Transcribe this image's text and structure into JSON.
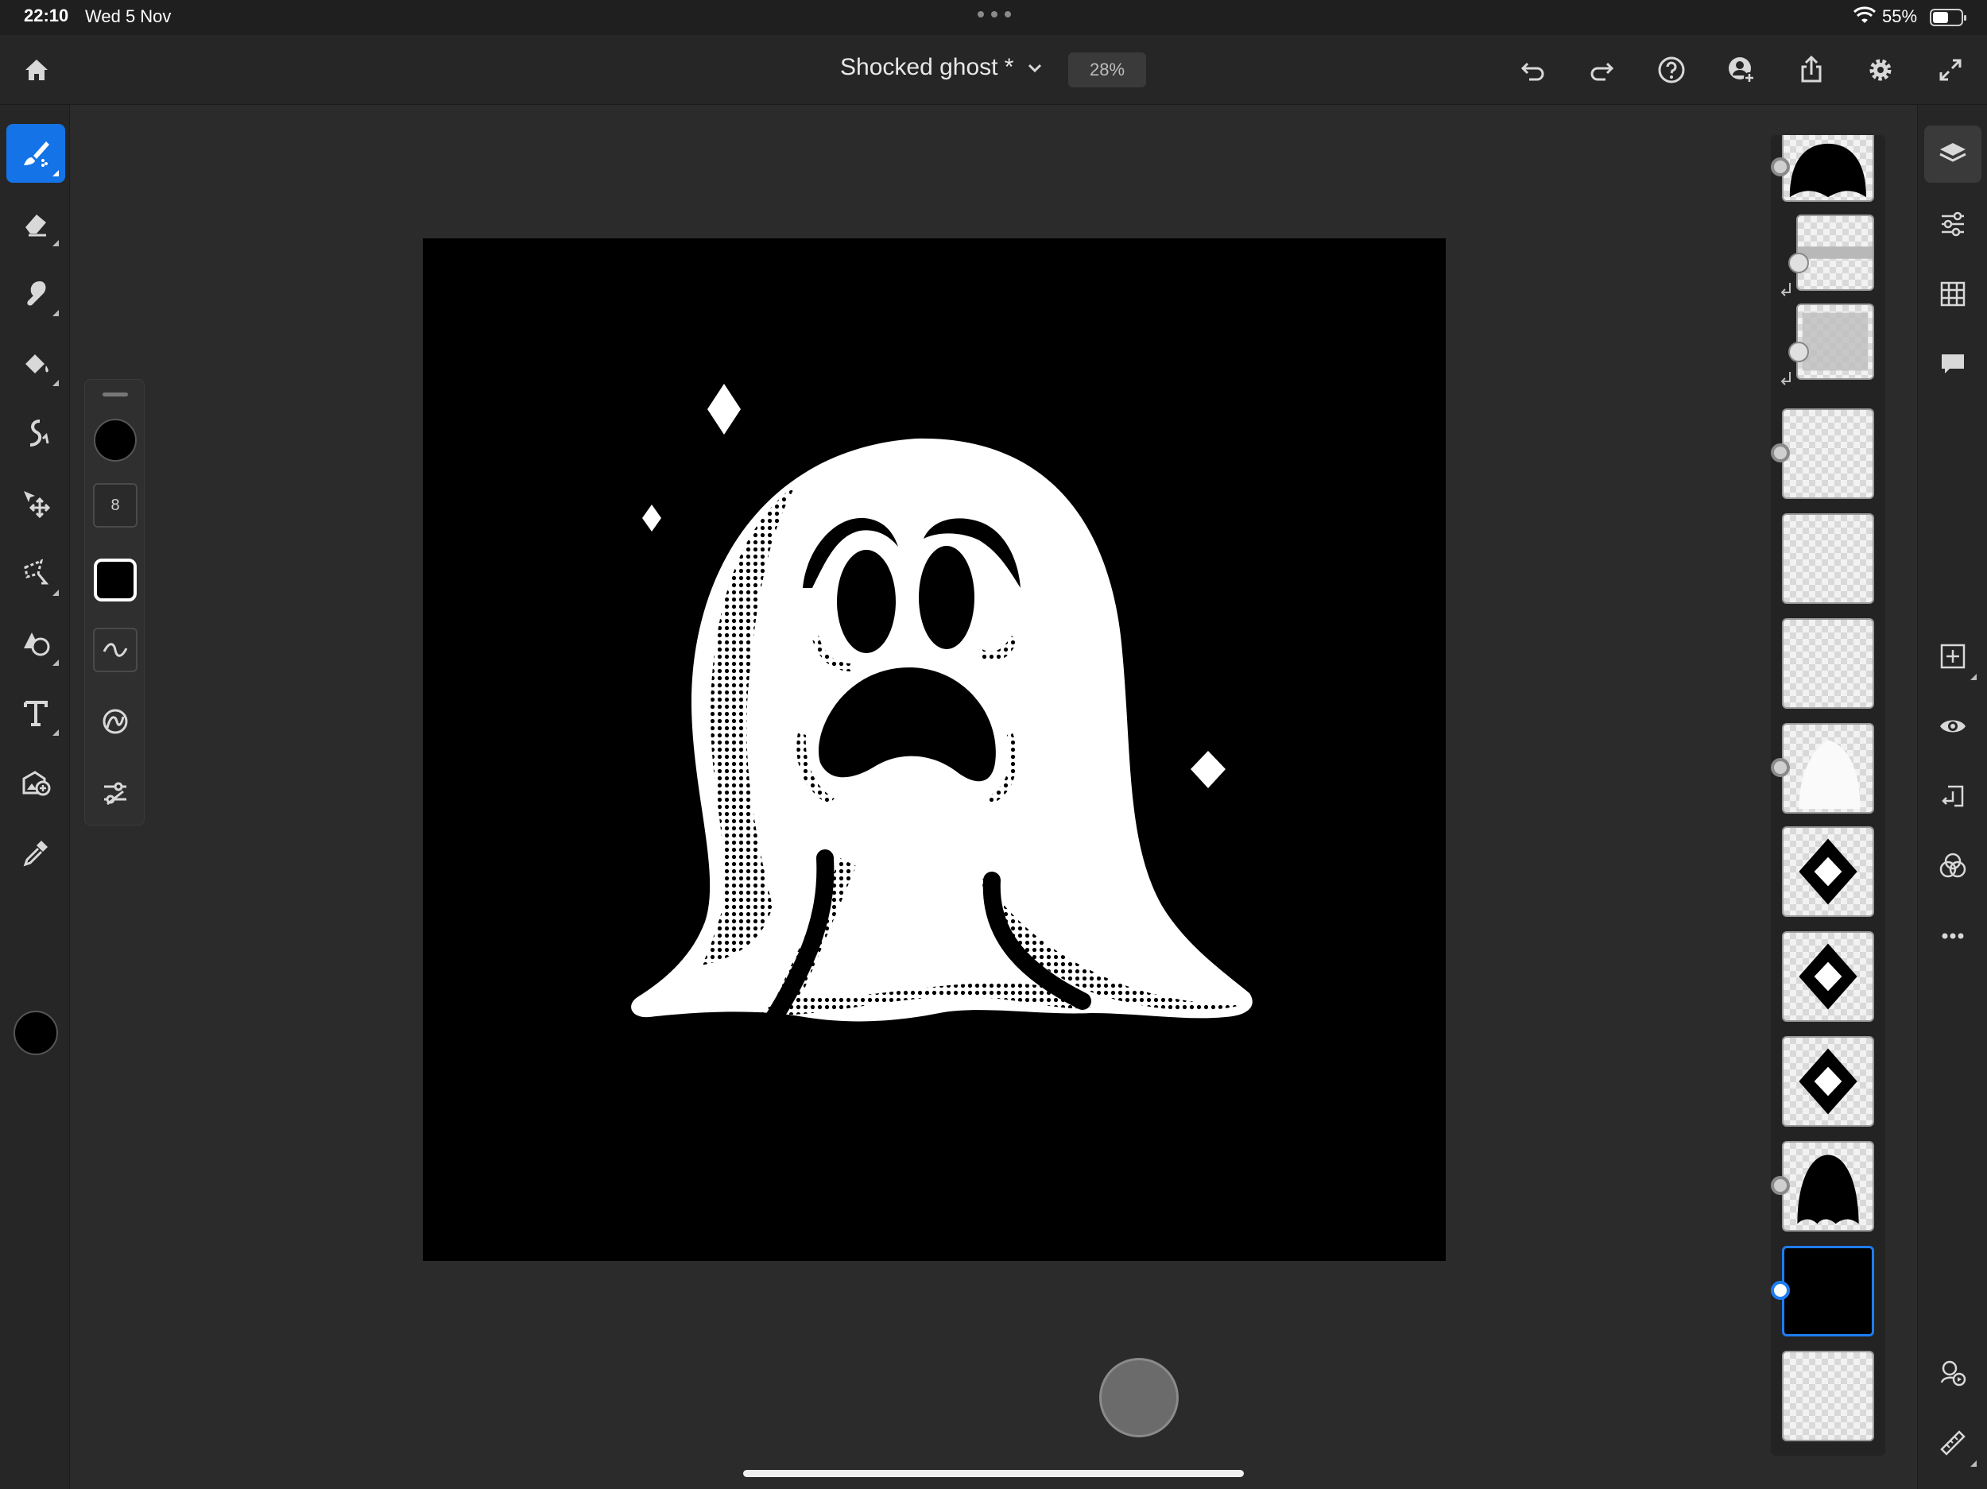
{
  "status_bar": {
    "time": "22:10",
    "date": "Wed 5 Nov",
    "battery_percent": "55%",
    "battery_level": 0.55
  },
  "header": {
    "document_title": "Shocked ghost *",
    "zoom": "28%",
    "icons": [
      "home-icon",
      "chevron-down-icon",
      "undo-icon",
      "redo-icon",
      "help-icon",
      "invite-icon",
      "share-icon",
      "settings-icon",
      "fullscreen-icon"
    ]
  },
  "tools": {
    "items": [
      "brush-tool",
      "eraser-tool",
      "smudge-tool",
      "fill-tool",
      "liquify-tool",
      "move-tool",
      "lasso-tool",
      "shape-tool",
      "type-tool",
      "place-image-tool",
      "eyedropper-tool"
    ],
    "active": "brush-tool",
    "foreground_color": "#000000"
  },
  "brush_panel": {
    "brush_size": "8",
    "brush_color": "#000000"
  },
  "layers": {
    "selected_index": 12,
    "count": 14
  },
  "right_rail": {
    "icons": [
      "layers-icon",
      "adjustments-icon",
      "grid-icon",
      "comments-icon",
      "add-layer-icon",
      "visibility-icon",
      "merge-down-icon",
      "blend-mode-icon",
      "more-icon",
      "timelapse-icon",
      "ruler-icon"
    ]
  },
  "colors": {
    "accent": "#1473e6",
    "canvas_background": "#000000",
    "ghost": "#ffffff"
  }
}
